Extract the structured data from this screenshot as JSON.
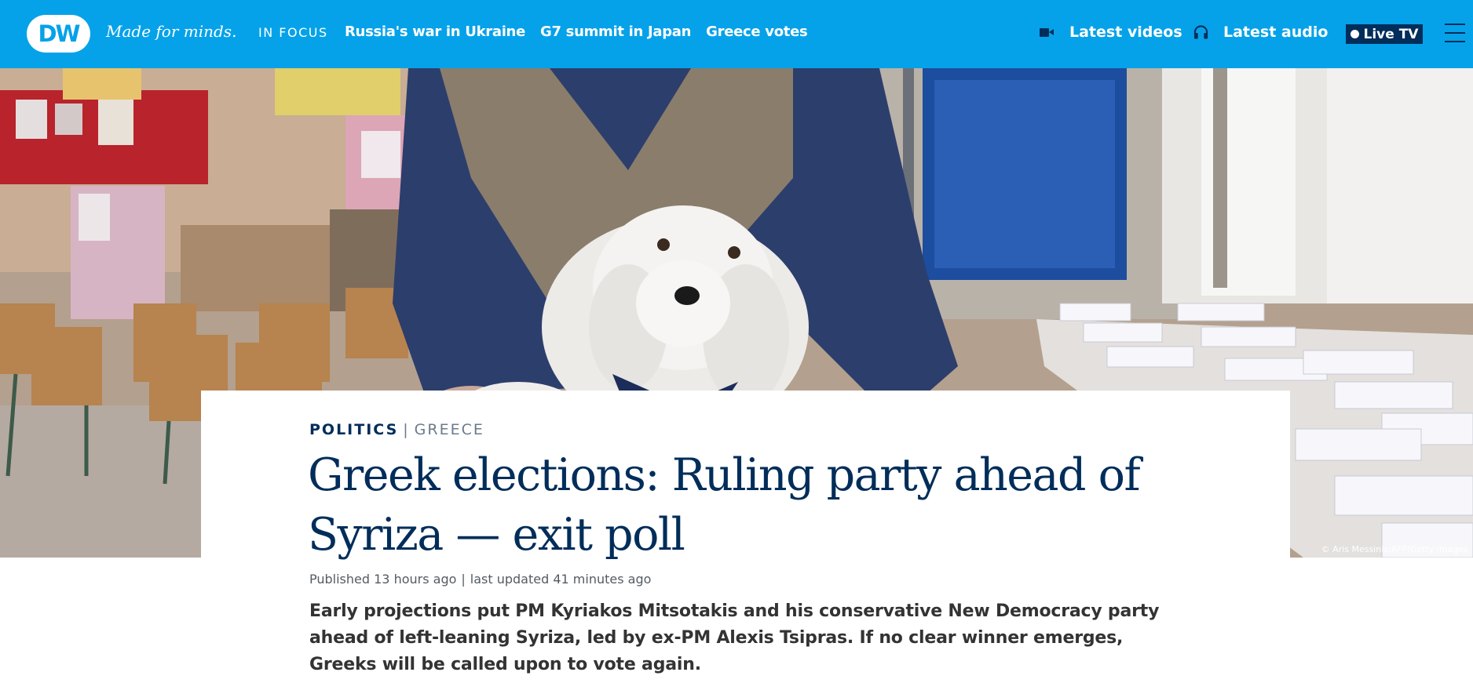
{
  "header": {
    "logo_text": "DW",
    "tagline": "Made for minds.",
    "in_focus_label": "IN FOCUS",
    "focus_links": [
      "Russia's war in Ukraine",
      "G7 summit in Japan",
      "Greece votes"
    ],
    "latest_videos": "Latest videos",
    "latest_audio": "Latest audio",
    "live_tv": "Live TV",
    "colors": {
      "bar": "#05a2e9",
      "navy": "#002d5a"
    }
  },
  "hero": {
    "photo_credit": "© Aris Messinis/AFP/Getty Images"
  },
  "article": {
    "category": "POLITICS",
    "subcategory": "GREECE",
    "headline": "Greek elections: Ruling party ahead of Syriza — exit poll",
    "published_label": "Published 13 hours ago",
    "updated_label": "last updated 41 minutes ago",
    "lead": "Early projections put PM Kyriakos Mitsotakis and his conservative New Democracy party ahead of left-leaning Syriza, led by ex-PM Alexis Tsipras. If no clear winner emerges, Greeks will be called upon to vote again."
  }
}
